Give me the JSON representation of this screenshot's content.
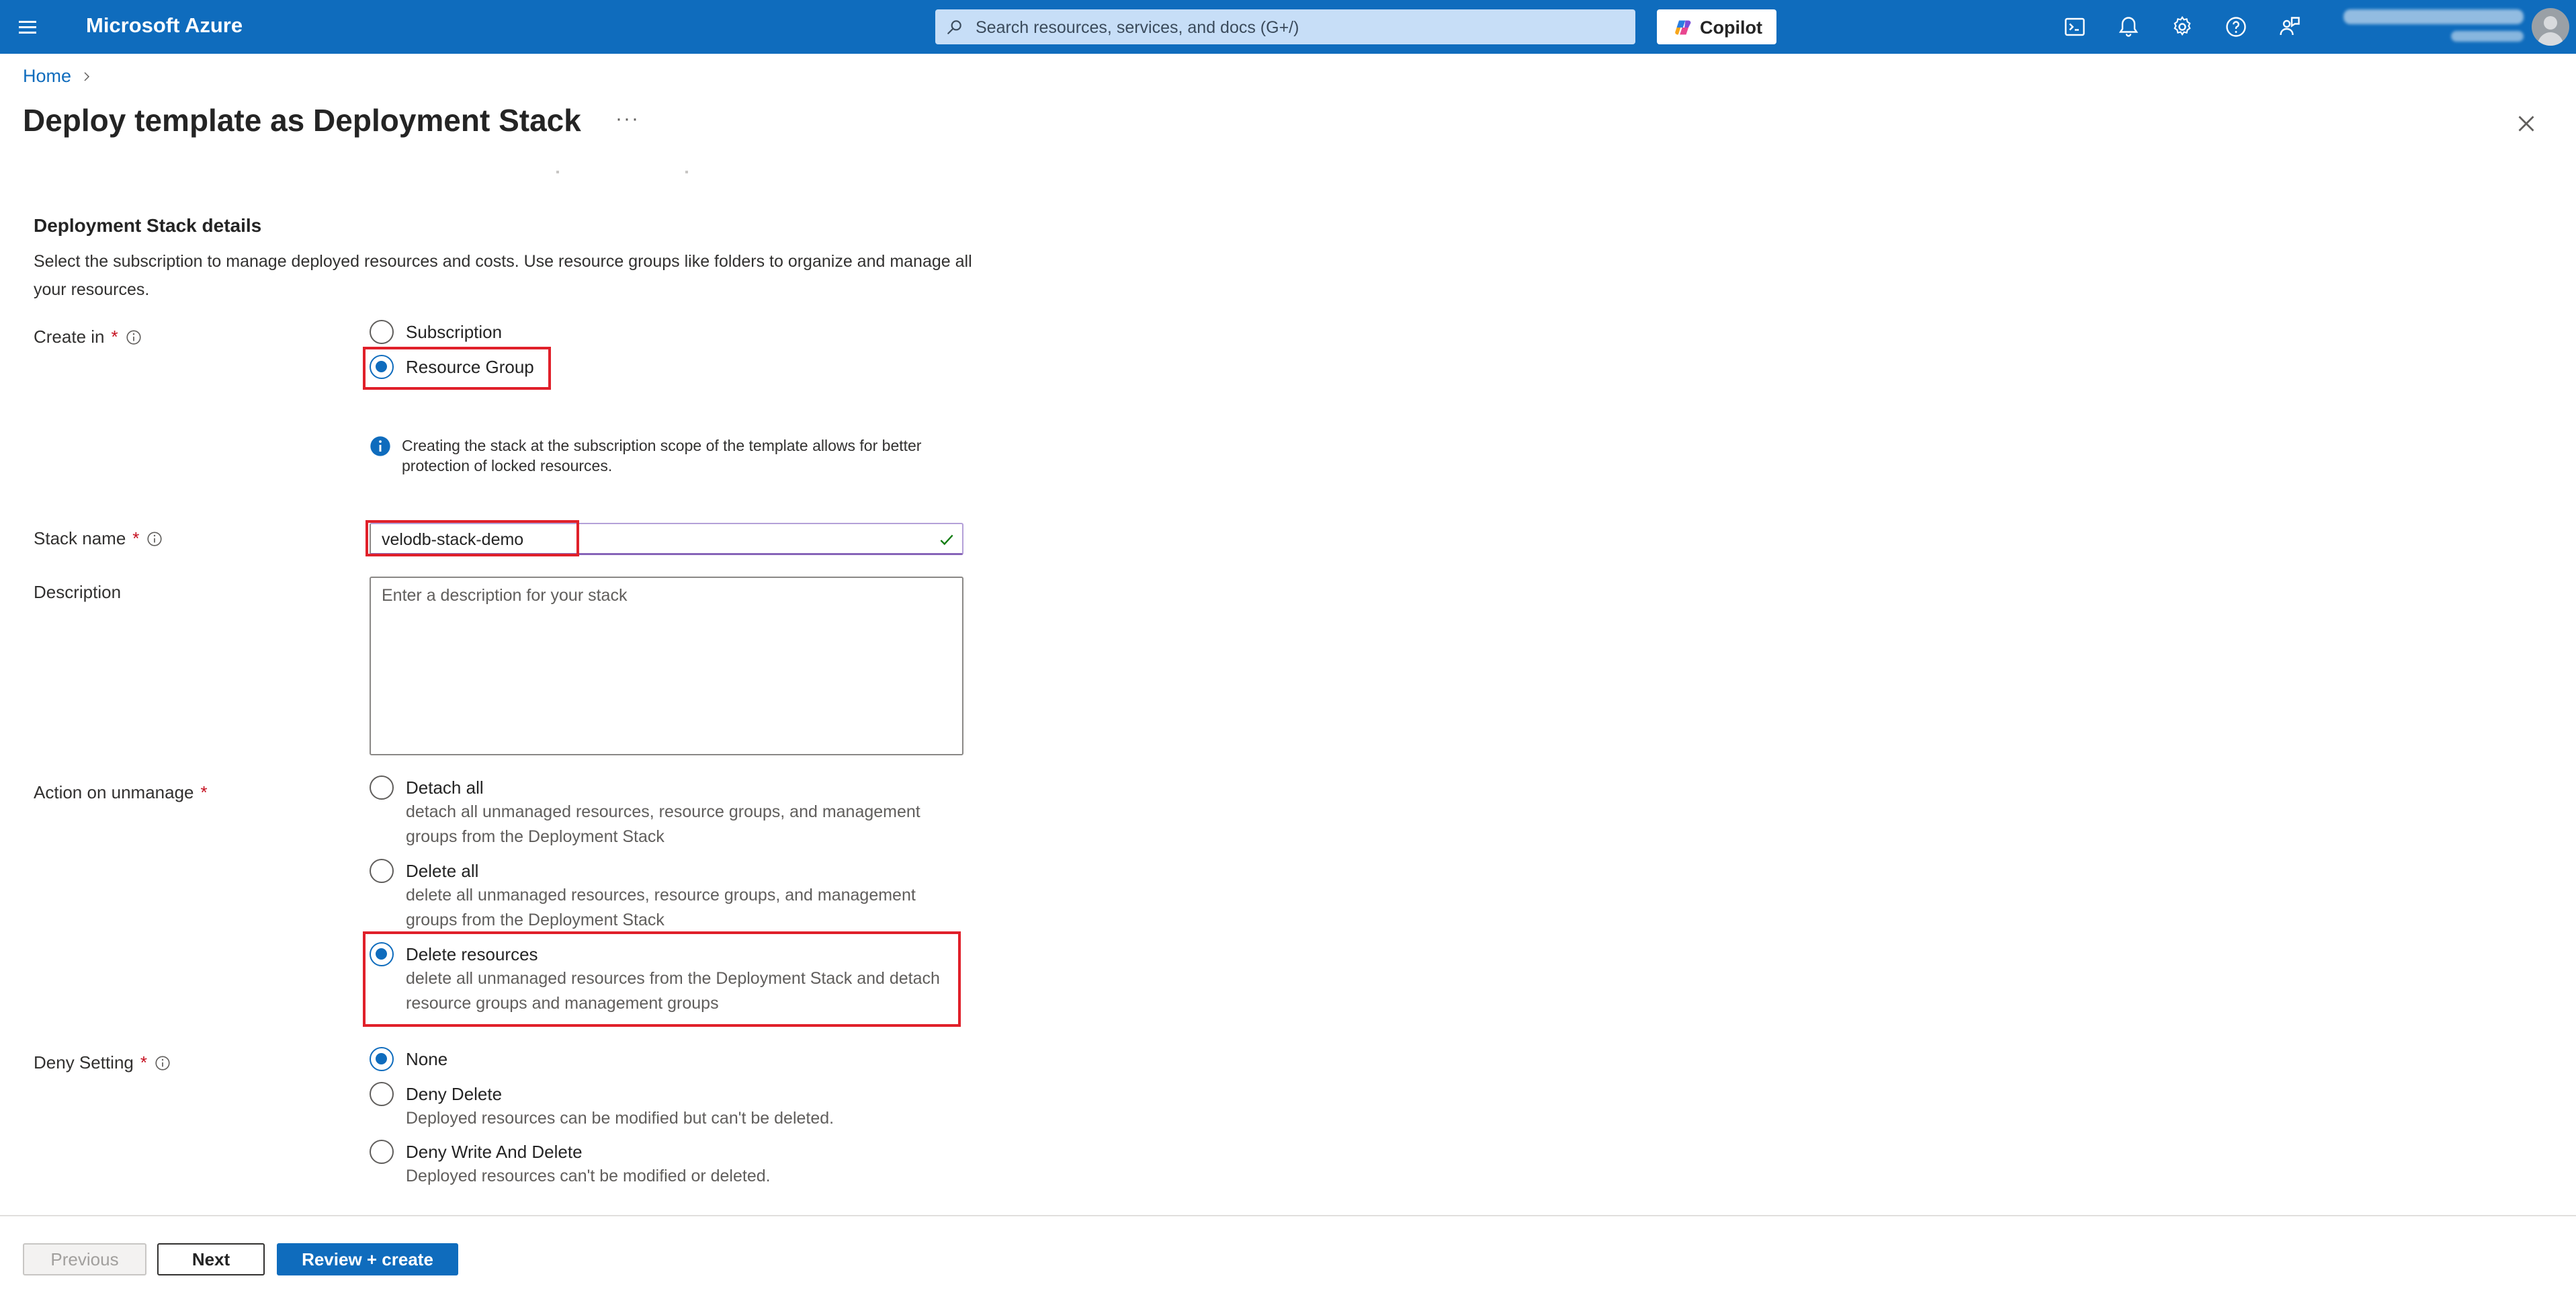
{
  "topbar": {
    "brand": "Microsoft Azure",
    "search_placeholder": "Search resources, services, and docs (G+/)",
    "copilot_label": "Copilot",
    "icons": [
      "cloud-shell-icon",
      "bell-icon",
      "gear-icon",
      "help-icon",
      "feedback-icon"
    ]
  },
  "breadcrumb": {
    "home": "Home"
  },
  "page": {
    "title": "Deploy template as Deployment Stack",
    "more": "···"
  },
  "section": {
    "title": "Deployment Stack details",
    "description": "Select the subscription to manage deployed resources and costs. Use resource groups like folders to organize and manage all your resources."
  },
  "create_in": {
    "label": "Create in",
    "options": [
      {
        "label": "Subscription",
        "selected": false
      },
      {
        "label": "Resource Group",
        "selected": true
      }
    ],
    "note": "Creating the stack at the subscription scope of the template allows for better protection of locked resources."
  },
  "stack_name": {
    "label": "Stack name",
    "value": "velodb-stack-demo"
  },
  "description_field": {
    "label": "Description",
    "placeholder": "Enter a description for your stack"
  },
  "action_on_unmanage": {
    "label": "Action on unmanage",
    "options": [
      {
        "label": "Detach all",
        "desc": "detach all unmanaged resources, resource groups, and management groups from the Deployment Stack",
        "selected": false
      },
      {
        "label": "Delete all",
        "desc": "delete all unmanaged resources, resource groups, and management groups from the Deployment Stack",
        "selected": false
      },
      {
        "label": "Delete resources",
        "desc": "delete all unmanaged resources from the Deployment Stack and detach resource groups and management groups",
        "selected": true
      }
    ]
  },
  "deny_setting": {
    "label": "Deny Setting",
    "options": [
      {
        "label": "None",
        "desc": "",
        "selected": true
      },
      {
        "label": "Deny Delete",
        "desc": "Deployed resources can be modified but can't be deleted.",
        "selected": false
      },
      {
        "label": "Deny Write And Delete",
        "desc": "Deployed resources can't be modified or deleted.",
        "selected": false
      }
    ]
  },
  "footer": {
    "previous": "Previous",
    "next": "Next",
    "review": "Review + create"
  },
  "colors": {
    "brand": "#0f6cbd",
    "highlight": "#e0202a",
    "required": "#c50f1f"
  }
}
